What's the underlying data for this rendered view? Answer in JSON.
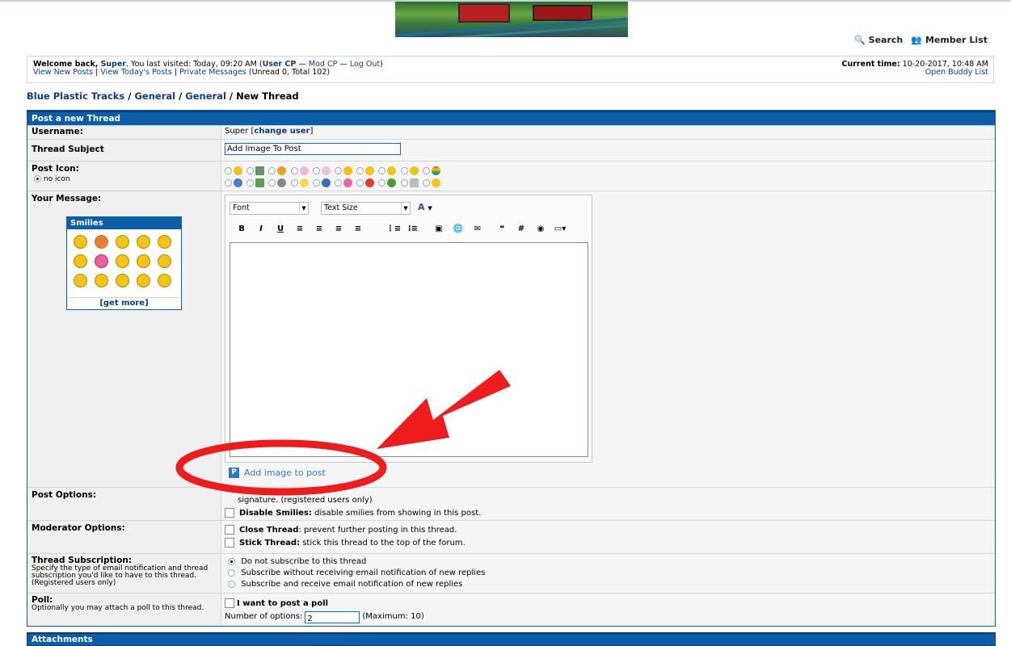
{
  "colors": {
    "header_blue": "#0d5ea8",
    "link_blue": "#0f3a86",
    "annotation_red": "#ee1c1c"
  },
  "nav": {
    "search": "Search",
    "member_list": "Member List"
  },
  "welcome": {
    "welcome_back": "Welcome back,",
    "user": "Super",
    "last_visited": ". You last visited: Today, 09:20 AM (",
    "user_cp": "User CP",
    "dash1": " — ",
    "mod_cp": "Mod CP",
    "dash2": " — ",
    "log_out": "Log Out",
    "close_paren": ")",
    "view_new_posts": "View New Posts",
    "view_todays_posts": "View Today's Posts",
    "private_messages": "Private Messages",
    "pm_counts": "(Unread 0, Total 102)",
    "current_time_label": "Current time:",
    "current_time": "10-20-2017, 10:48 AM",
    "open_buddy_list": "Open Buddy List"
  },
  "breadcrumb": {
    "items": [
      "Blue Plastic Tracks",
      "General",
      "General"
    ],
    "current": "New Thread"
  },
  "form": {
    "title": "Post a new Thread",
    "username_label": "Username:",
    "username": "Super",
    "change_user": "change user",
    "subject_label": "Thread Subject",
    "subject_value": "Add Image To Post",
    "post_icon_label": "Post Icon:",
    "no_icon": "no icon",
    "message_label": "Your Message:",
    "font_select": "Font",
    "size_select": "Text Size",
    "smilies_title": "Smilies",
    "get_more": "[get more]",
    "add_image": "Add image to post",
    "post_options_label": "Post Options:",
    "sig_text": "signature. (registered users only)",
    "disable_smilies_bold": "Disable Smilies:",
    "disable_smilies_text": "disable smilies from showing in this post.",
    "mod_options_label": "Moderator Options:",
    "close_thread_bold": "Close Thread",
    "close_thread_text": ": prevent further posting in this thread.",
    "stick_thread_bold": "Stick Thread:",
    "stick_thread_text": "stick this thread to the top of the forum.",
    "subscription_label": "Thread Subscription:",
    "subscription_desc": "Specify the type of email notification and thread subscription you'd like to have to this thread. (Registered users only)",
    "sub_opt1": "Do not subscribe to this thread",
    "sub_opt2": "Subscribe without receiving email notification of new replies",
    "sub_opt3": "Subscribe and receive email notification of new replies",
    "poll_label": "Poll:",
    "poll_desc": "Optionally you may attach a poll to this thread.",
    "poll_check": "I want to post a poll",
    "num_options_label": "Number of options:",
    "num_options_value": "2",
    "max_label": "(Maximum: 10)"
  },
  "attachments_title": "Attachments"
}
